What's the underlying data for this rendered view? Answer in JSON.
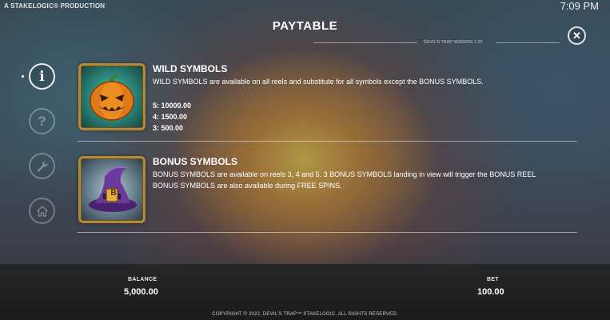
{
  "topbar": {
    "producer": "A STAKELOGIC® PRODUCTION",
    "clock": "7:09 PM"
  },
  "header": {
    "title": "PAYTABLE",
    "version": "DEVIL'S TRAP VERSION 1.22"
  },
  "sidebar": {
    "items": [
      {
        "icon": "info-icon",
        "active": true
      },
      {
        "icon": "help-icon",
        "active": false
      },
      {
        "icon": "wrench-icon",
        "active": false
      },
      {
        "icon": "home-icon",
        "active": false
      }
    ]
  },
  "sections": {
    "wild": {
      "icon": "jack-o-lantern-icon",
      "heading": "WILD SYMBOLS",
      "description": "WILD SYMBOLS are available on all reels and substitute for all symbols except the BONUS SYMBOLS.",
      "payouts": [
        "5: 10000.00",
        "4: 1500.00",
        "3: 500.00"
      ]
    },
    "bonus": {
      "icon": "witch-hat-icon",
      "hat_letter": "B",
      "heading": "BONUS SYMBOLS",
      "description_1": "BONUS SYMBOLS are available on reels 3, 4 and 5. 3 BONUS SYMBOLS landing in view will trigger the BONUS REEL",
      "description_2": "BONUS SYMBOLS are also available during FREE SPINS."
    }
  },
  "footer": {
    "balance_label": "BALANCE",
    "balance_value": "5,000.00",
    "bet_label": "BET",
    "bet_value": "100.00",
    "copyright": "COPYRIGHT © 2022, DEVIL'S TRAP™ STAKELOGIC. ALL RIGHTS RESERVED."
  },
  "colors": {
    "frame_gold": "#b58a37",
    "pumpkin_orange": "#e07a18",
    "hat_purple": "#6b3a9c"
  }
}
